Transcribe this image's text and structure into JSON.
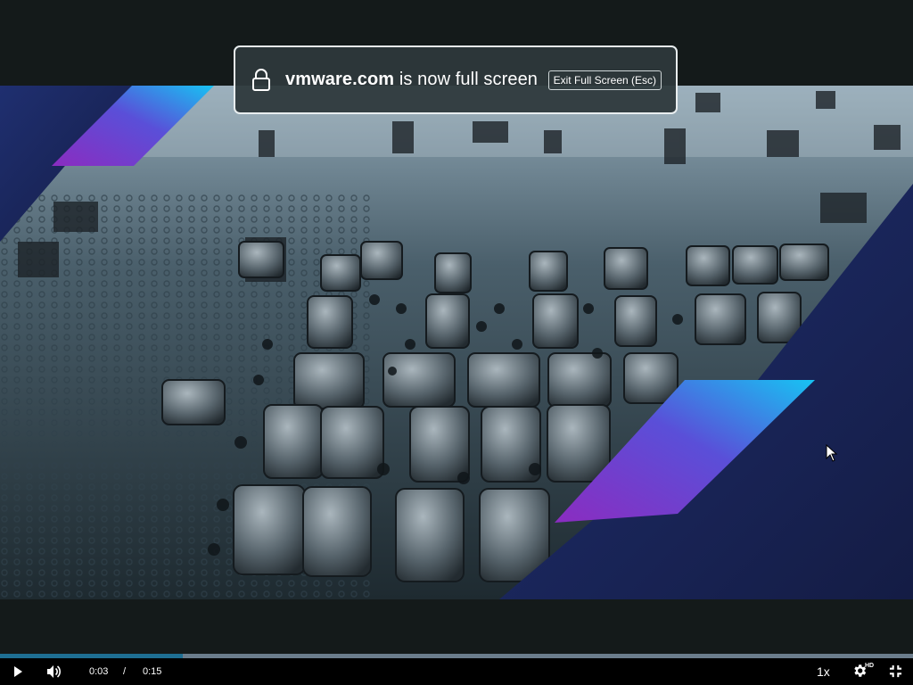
{
  "notification": {
    "domain": "vmware.com",
    "message": " is now full screen",
    "exit_label": "Exit Full Screen (Esc)",
    "icon": "lock-icon"
  },
  "player": {
    "current_time": "0:03",
    "separator": "/",
    "duration": "0:15",
    "progress_fraction": 0.2,
    "speed_label": "1x",
    "quality_badge": "HD",
    "accent_color": "#1e6f93",
    "icons": [
      "play-icon",
      "volume-icon",
      "gear-icon",
      "exit-fullscreen-icon"
    ]
  }
}
